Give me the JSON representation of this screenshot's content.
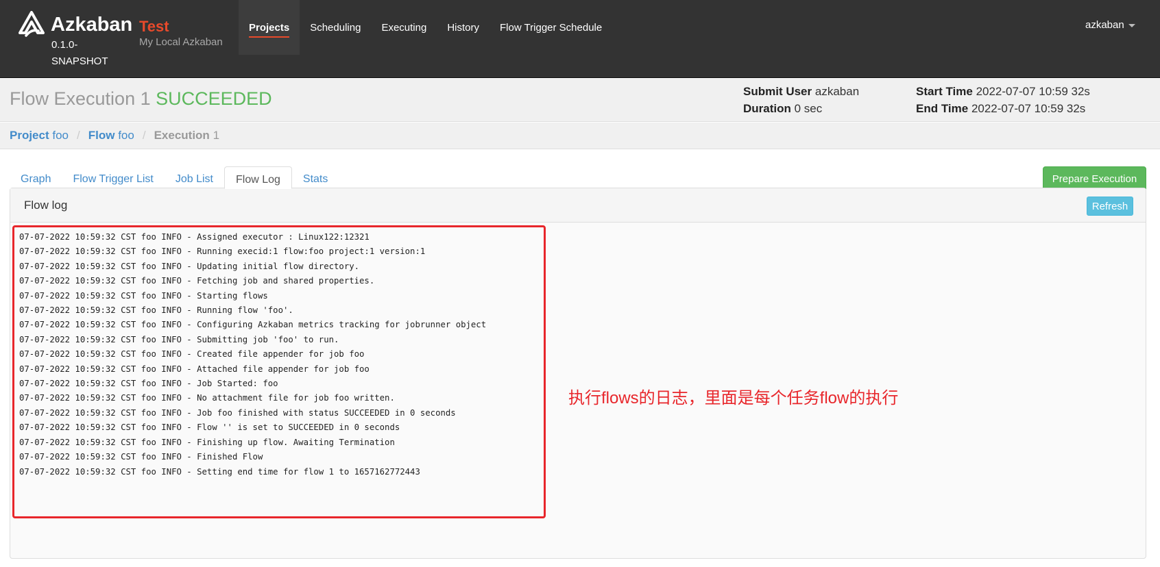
{
  "brand": {
    "name": "Azkaban",
    "version": "0.1.0-SNAPSHOT",
    "env_name": "Test",
    "env_desc": "My Local Azkaban"
  },
  "nav": {
    "items": [
      "Projects",
      "Scheduling",
      "Executing",
      "History",
      "Flow Trigger Schedule"
    ],
    "active": "Projects"
  },
  "user": {
    "name": "azkaban"
  },
  "header": {
    "title": "Flow Execution 1",
    "status": "SUCCEEDED",
    "submit_user_label": "Submit User",
    "submit_user": "azkaban",
    "duration_label": "Duration",
    "duration": "0 sec",
    "start_time_label": "Start Time",
    "start_time": "2022-07-07 10:59 32s",
    "end_time_label": "End Time",
    "end_time": "2022-07-07 10:59 32s"
  },
  "breadcrumb": {
    "project_label": "Project",
    "project": "foo",
    "flow_label": "Flow",
    "flow": "foo",
    "execution_label": "Execution",
    "execution": "1"
  },
  "tabs": [
    "Graph",
    "Flow Trigger List",
    "Job List",
    "Flow Log",
    "Stats"
  ],
  "active_tab": "Flow Log",
  "prepare_button": "Prepare Execution",
  "panel": {
    "title": "Flow log",
    "refresh_button": "Refresh"
  },
  "log_lines": [
    "07-07-2022 10:59:32 CST foo INFO - Assigned executor : Linux122:12321",
    "07-07-2022 10:59:32 CST foo INFO - Running execid:1 flow:foo project:1 version:1",
    "07-07-2022 10:59:32 CST foo INFO - Updating initial flow directory.",
    "07-07-2022 10:59:32 CST foo INFO - Fetching job and shared properties.",
    "07-07-2022 10:59:32 CST foo INFO - Starting flows",
    "07-07-2022 10:59:32 CST foo INFO - Running flow 'foo'.",
    "07-07-2022 10:59:32 CST foo INFO - Configuring Azkaban metrics tracking for jobrunner object",
    "07-07-2022 10:59:32 CST foo INFO - Submitting job 'foo' to run.",
    "07-07-2022 10:59:32 CST foo INFO - Created file appender for job foo",
    "07-07-2022 10:59:32 CST foo INFO - Attached file appender for job foo",
    "07-07-2022 10:59:32 CST foo INFO - Job Started: foo",
    "07-07-2022 10:59:32 CST foo INFO - No attachment file for job foo written.",
    "07-07-2022 10:59:32 CST foo INFO - Job foo finished with status SUCCEEDED in 0 seconds",
    "07-07-2022 10:59:32 CST foo INFO - Flow '' is set to SUCCEEDED in 0 seconds",
    "07-07-2022 10:59:32 CST foo INFO - Finishing up flow. Awaiting Termination",
    "07-07-2022 10:59:32 CST foo INFO - Finished Flow",
    "07-07-2022 10:59:32 CST foo INFO - Setting end time for flow 1 to 1657162772443"
  ],
  "annotation": "执行flows的日志，里面是每个任务flow的执行",
  "colors": {
    "navbar": "#333333",
    "accent": "#e84a2b",
    "success": "#5cb85c",
    "link": "#428bca",
    "info": "#5bc0de",
    "annotation": "#e8262b"
  }
}
